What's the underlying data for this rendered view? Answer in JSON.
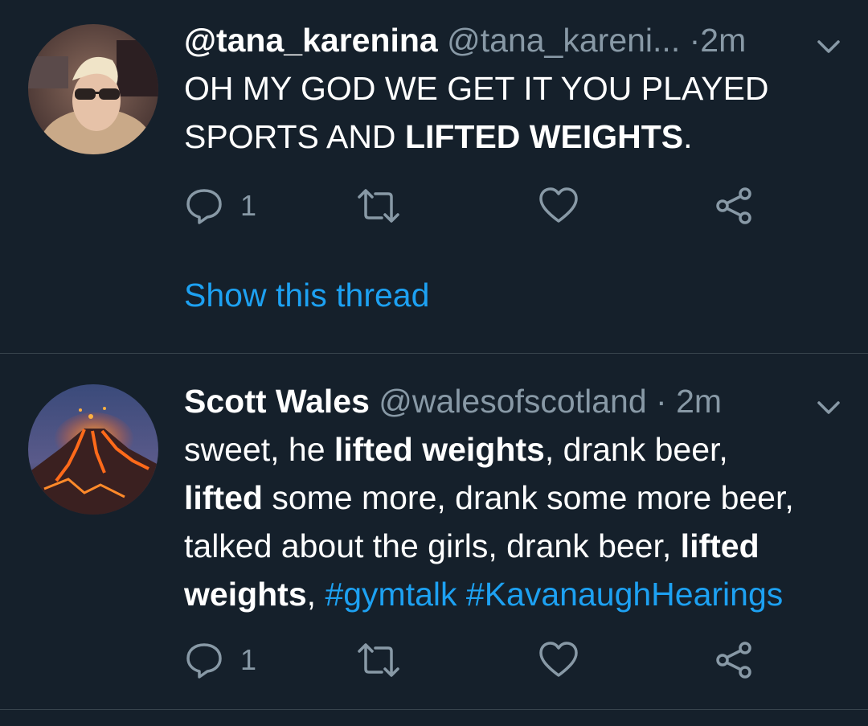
{
  "tweets": [
    {
      "name": "@tana_karenina",
      "handle": "@tana_kareni...",
      "dot": "·",
      "time": "2m",
      "body": {
        "line1": "OH MY GOD WE GET IT YOU PLAYED",
        "line2_a": "SPORTS AND ",
        "line2_b": "LIFTED WEIGHTS",
        "line2_c": "."
      },
      "reply_count": "1",
      "show_thread": "Show this thread"
    },
    {
      "name": "Scott Wales",
      "handle": "@walesofscotland",
      "dot": "·",
      "time": "2m",
      "body": {
        "l1_a": "sweet, he ",
        "l1_b": "lifted weights",
        "l1_c": ", drank beer,",
        "l2_a": "lifted",
        "l2_b": " some more, drank some more beer,",
        "l3_a": "talked about the girls, drank beer, ",
        "l3_b": "lifted",
        "l4_a": "weights",
        "l4_b": ", ",
        "l4_c": "#gymtalk",
        "l4_d": " ",
        "l4_e": "#KavanaughHearings"
      },
      "reply_count": "1"
    }
  ],
  "icons": {
    "reply": "reply-icon",
    "retweet": "retweet-icon",
    "like": "heart-icon",
    "share": "share-icon",
    "more": "chevron-down-icon"
  },
  "colors": {
    "background": "#15202b",
    "text": "#ffffff",
    "secondary": "#8899a6",
    "link": "#1da1f2",
    "divider": "#38444d"
  }
}
